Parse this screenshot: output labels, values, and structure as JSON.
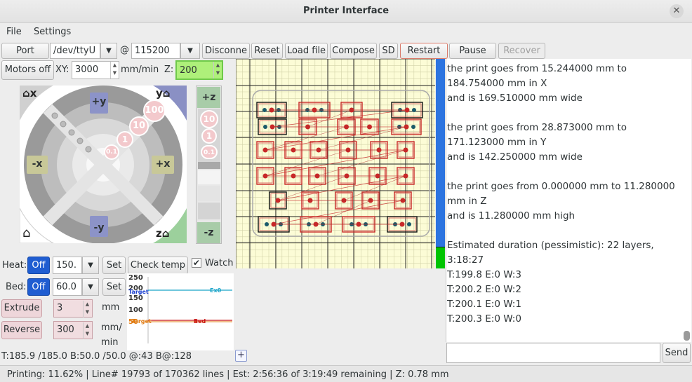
{
  "window": {
    "title": "Printer Interface"
  },
  "menu": [
    "File",
    "Settings"
  ],
  "toolbar": {
    "port_label": "Port",
    "port_value": "/dev/ttyU",
    "at": "@",
    "baud_value": "115200",
    "disconnect": "Disconne",
    "reset": "Reset",
    "load_file": "Load file",
    "compose": "Compose",
    "sd": "SD",
    "restart": "Restart",
    "pause": "Pause",
    "recover": "Recover"
  },
  "motors": {
    "motors_off": "Motors off",
    "xy_label": "XY:",
    "xy_value": "3000",
    "unit": "mm/min",
    "z_label": "Z:",
    "z_value": "200"
  },
  "jog": {
    "home_x": "x",
    "home_y": "y",
    "home_z": "z",
    "plus_y": "+y",
    "minus_y": "-y",
    "minus_x": "-x",
    "plus_x": "+x",
    "steps": [
      "100",
      "10",
      "1",
      "0.1"
    ],
    "z_plus": "+z",
    "z_minus": "-z",
    "z_steps": [
      "10",
      "1",
      "0.1"
    ]
  },
  "temps": {
    "heat_label": "Heat:",
    "heat_off": "Off",
    "heat_value": "150.",
    "heat_set": "Set",
    "check_temp": "Check temp",
    "watch": "Watch",
    "bed_label": "Bed:",
    "bed_off": "Off",
    "bed_value": "60.0",
    "bed_set": "Set"
  },
  "graph": {
    "ticks": [
      "250",
      "200",
      "150",
      "100",
      "50"
    ],
    "target_label": "Target",
    "ex0_label": "Ex0",
    "target_bed_label": "Target",
    "bed_label": "Bed",
    "series_colors": {
      "ex0": "#18a3c8",
      "target": "#1a3fd0",
      "bed": "#c81010",
      "bed_target": "#e07a10"
    }
  },
  "extrude": {
    "extrude_label": "Extrude",
    "extrude_value": "3",
    "mm": "mm",
    "reverse_label": "Reverse",
    "reverse_value": "300",
    "mm_min_1": "mm/",
    "mm_min_2": "min"
  },
  "temp_readout": "T:185.9 /185.0 B:50.0 /50.0 @:43 B@:128",
  "plus_small": "+",
  "log": {
    "lines": [
      "the print goes from 15.244000 mm to",
      "184.754000 mm in X",
      "and is 169.510000 mm wide",
      "",
      "the print goes from 28.873000 mm to",
      "171.123000 mm in Y",
      "and is 142.250000 mm wide",
      "",
      "the print goes from 0.000000 mm to 11.280000",
      "mm in Z",
      "and is 11.280000 mm high",
      "",
      "Estimated duration (pessimistic):  22 layers,",
      "3:18:27",
      "T:199.8 E:0 W:3",
      "T:200.2 E:0 W:2",
      "T:200.1 E:0 W:1",
      "T:200.3 E:0 W:0"
    ]
  },
  "command": {
    "send": "Send",
    "value": ""
  },
  "status": "Printing: 11.62% | Line# 19793 of 170362 lines | Est: 2:56:36 of 3:19:49 remaining |  Z: 0.78 mm",
  "progress": {
    "fraction": 0.1162
  }
}
